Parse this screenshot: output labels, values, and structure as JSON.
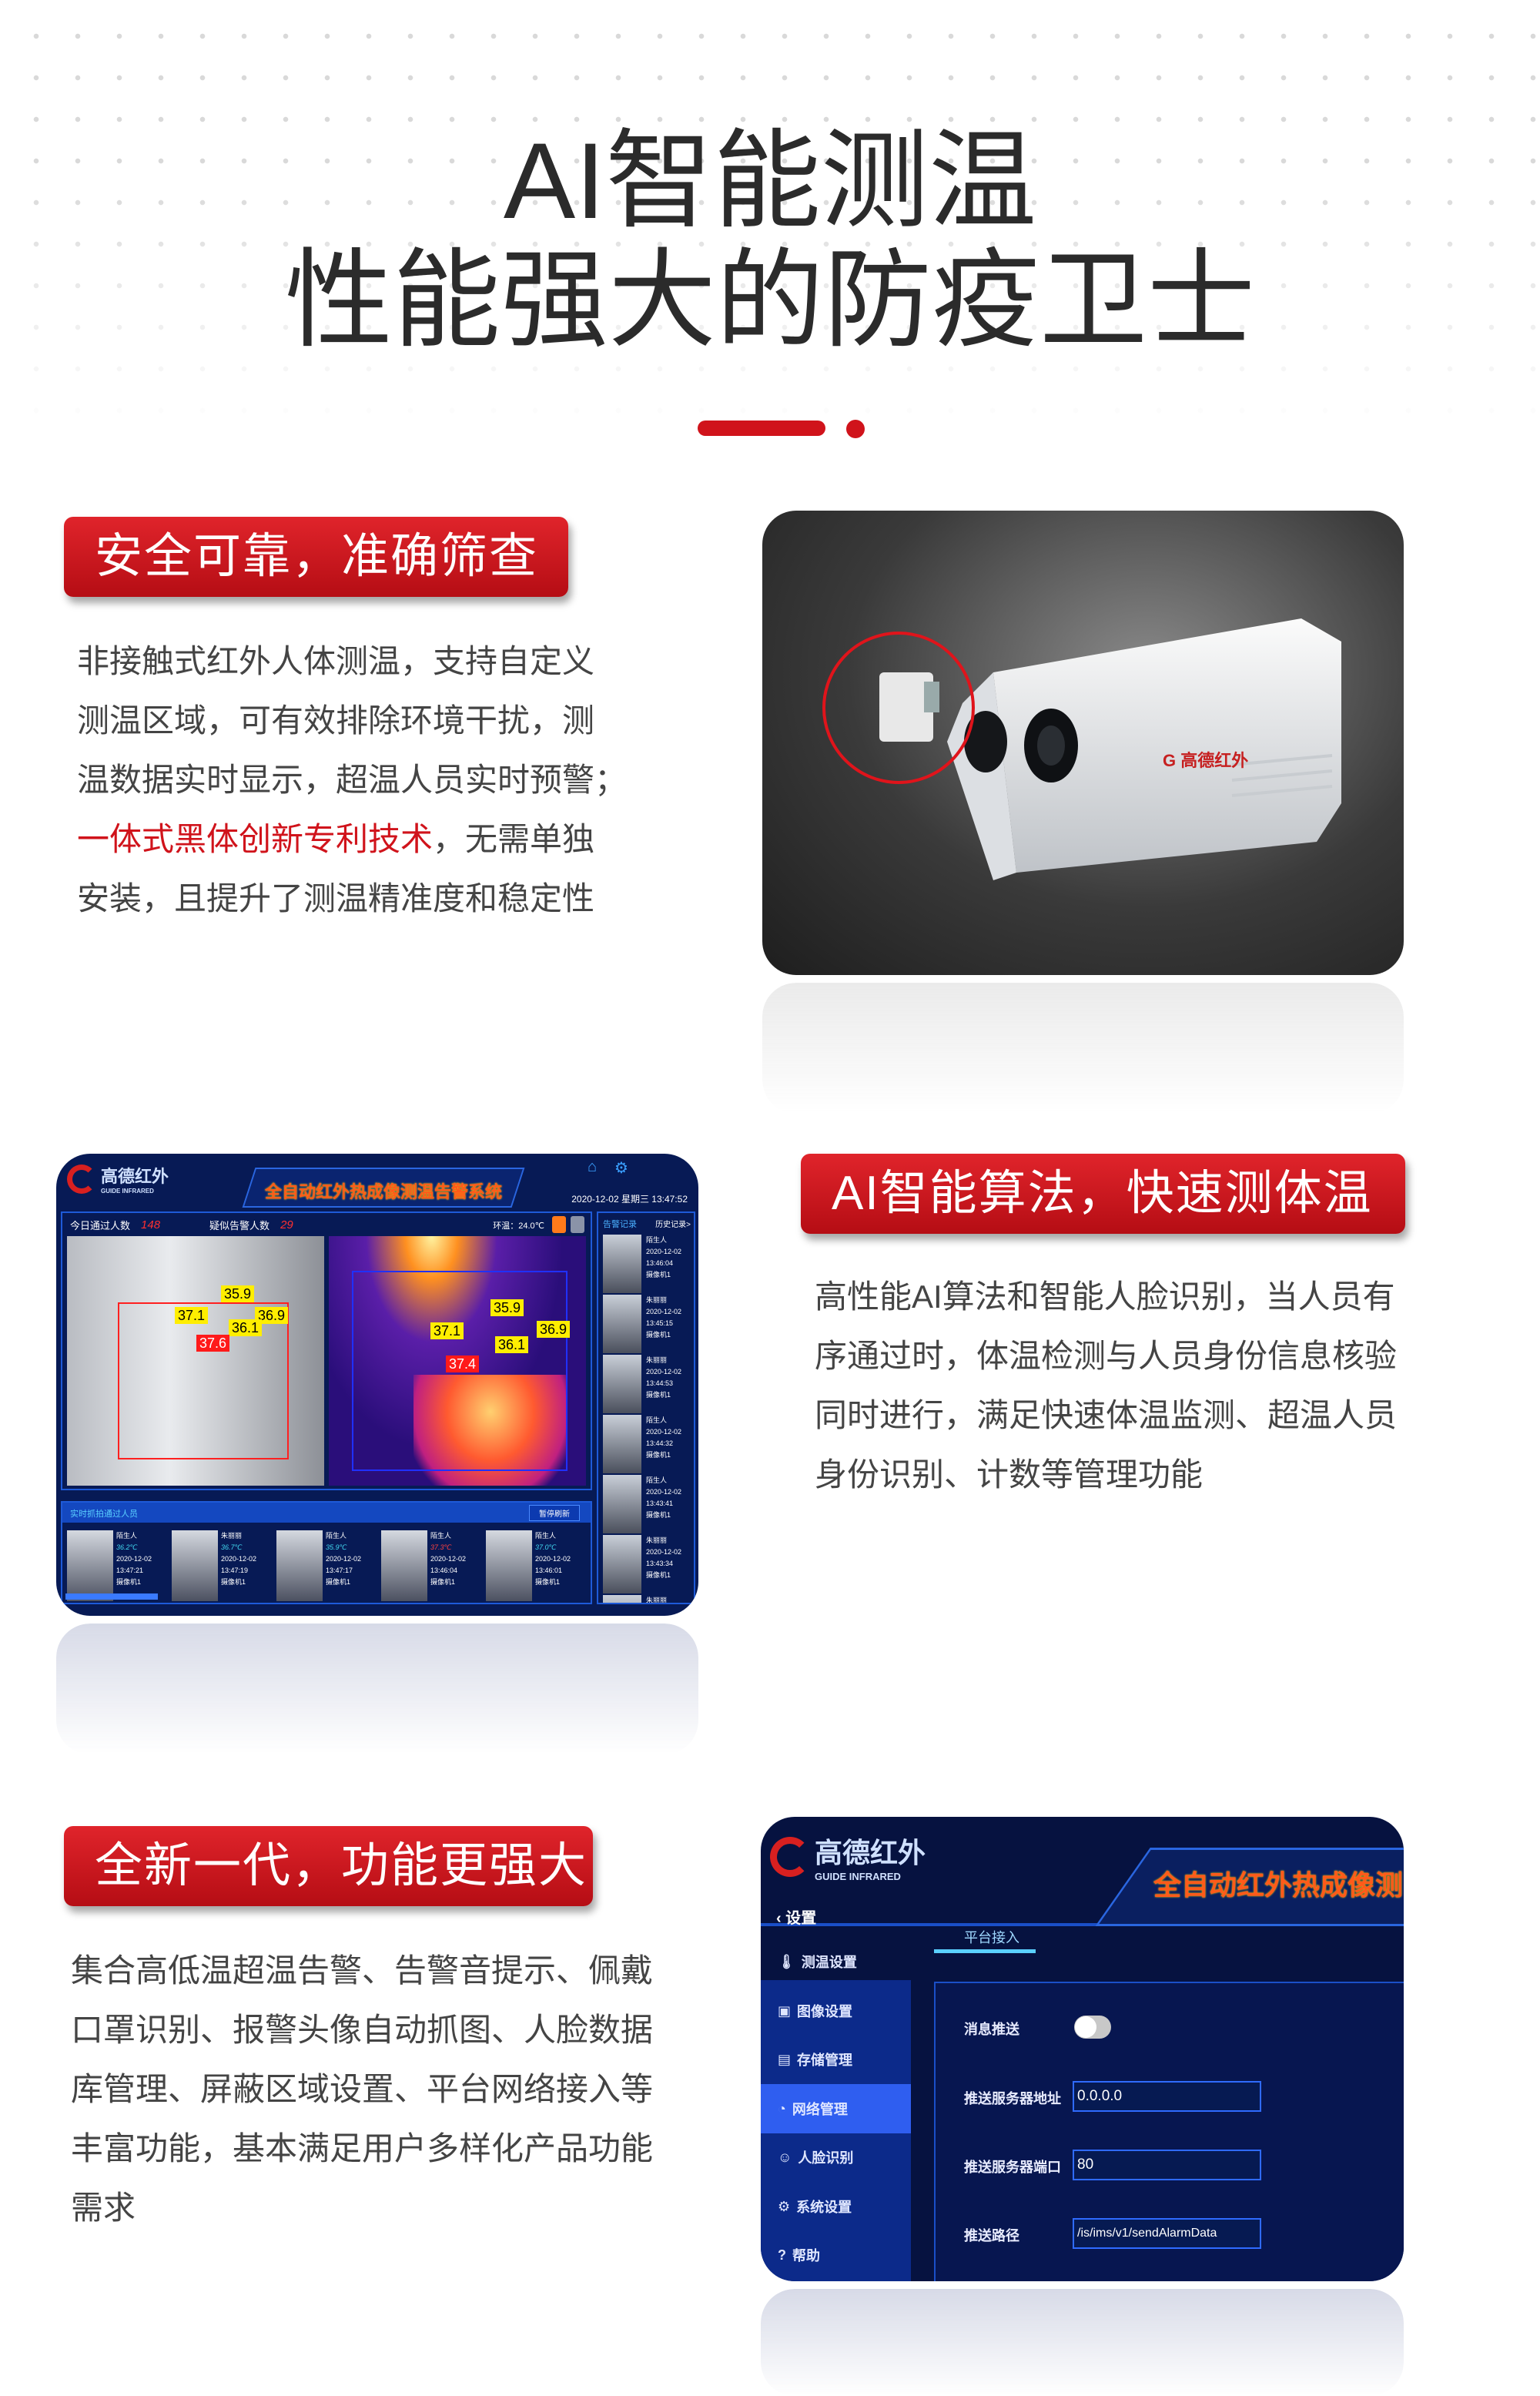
{
  "hero": {
    "title_line1": "AI智能测温",
    "title_line2": "性能强大的防疫卫士"
  },
  "colors": {
    "accent": "#d0131b",
    "ui_bg": "#071a55",
    "ui_active": "#2f5ef0"
  },
  "section1": {
    "badge": "安全可靠，准确筛查",
    "lines": [
      "非接触式红外人体测温，支持自定义",
      "测温区域，可有效排除环境干扰，测",
      "温数据实时显示，超温人员实时预警；",
      null,
      "安装，且提升了测温精准度和稳定性"
    ],
    "line4_red": "一体式黑体创新专利技术",
    "line4_rest": "，无需单独",
    "camera_logo": "高德红外",
    "camera_logo_sub": "GUIDE INFRARED"
  },
  "section2": {
    "badge": "AI智能算法，快速测体温",
    "lines": [
      "高性能AI算法和智能人脸识别，当人员有",
      "序通过时，体温检测与人员身份信息核验",
      "同时进行，满足快速体温监测、超温人员",
      "身份识别、计数等管理功能"
    ]
  },
  "dashboard": {
    "logo": "高德红外",
    "logo_sub": "GUIDE INFRARED",
    "title": "全自动红外热成像测温告警系统",
    "datetime": "2020-12-02 星期三 13:47:52",
    "passed_label": "今日通过人数",
    "passed_value": "148",
    "alarm_label": "疑似告警人数",
    "alarm_value": "29",
    "ambient": "环温：24.0℃",
    "visible_tags": [
      "35.9",
      "37.1",
      "36.9",
      "36.1",
      "37.6"
    ],
    "thermal_tags": [
      "35.9",
      "37.1",
      "36.9",
      "36.1",
      "37.4"
    ],
    "records_tab": "告警记录",
    "history_tab": "历史记录>",
    "records": [
      {
        "name": "陌生人",
        "date": "2020-12-02",
        "time": "13:46:04",
        "cam": "摄像机1"
      },
      {
        "name": "朱丽丽",
        "date": "2020-12-02",
        "time": "13:45:15",
        "cam": "摄像机1"
      },
      {
        "name": "朱丽丽",
        "date": "2020-12-02",
        "time": "13:44:53",
        "cam": "摄像机1"
      },
      {
        "name": "陌生人",
        "date": "2020-12-02",
        "time": "13:44:32",
        "cam": "摄像机1"
      },
      {
        "name": "陌生人",
        "date": "2020-12-02",
        "time": "13:43:41",
        "cam": "摄像机1"
      },
      {
        "name": "朱丽丽",
        "date": "2020-12-02",
        "time": "13:43:34",
        "cam": "摄像机1"
      },
      {
        "name": "朱丽丽"
      }
    ],
    "capture_title": "实时抓拍通过人员",
    "pause_button": "暂停刷新",
    "captures": [
      {
        "name": "陌生人",
        "temp": "36.2℃",
        "date": "2020-12-02",
        "time": "13:47:21",
        "cam": "摄像机1"
      },
      {
        "name": "朱丽丽",
        "temp": "36.7℃",
        "date": "2020-12-02",
        "time": "13:47:19",
        "cam": "摄像机1"
      },
      {
        "name": "陌生人",
        "temp": "35.9℃",
        "date": "2020-12-02",
        "time": "13:47:17",
        "cam": "摄像机1"
      },
      {
        "name": "陌生人",
        "temp": "37.3℃",
        "date": "2020-12-02",
        "time": "13:46:04",
        "cam": "摄像机1"
      },
      {
        "name": "陌生人",
        "temp": "37.0℃",
        "date": "2020-12-02",
        "time": "13:46:01",
        "cam": "摄像机1"
      }
    ]
  },
  "section3": {
    "badge": "全新一代，功能更强大",
    "lines": [
      "集合高低温超温告警、告警音提示、佩戴",
      "口罩识别、报警头像自动抓图、人脸数据",
      "库管理、屏蔽区域设置、平台网络接入等",
      "丰富功能，基本满足用户多样化产品功能",
      "需求"
    ]
  },
  "settings": {
    "logo": "高德红外",
    "logo_sub": "GUIDE INFRARED",
    "title": "全自动红外热成像测",
    "back_label": "设置",
    "menu": [
      {
        "label": "测温设置",
        "icon": "thermometer-icon"
      },
      {
        "label": "图像设置",
        "icon": "image-icon"
      },
      {
        "label": "存储管理",
        "icon": "storage-icon"
      },
      {
        "label": "网络管理",
        "icon": "network-icon",
        "active": true
      },
      {
        "label": "人脸识别",
        "icon": "face-icon"
      },
      {
        "label": "系统设置",
        "icon": "gear-icon"
      },
      {
        "label": "帮助",
        "icon": "help-icon"
      }
    ],
    "tab": "平台接入",
    "push_label": "消息推送",
    "push_enabled": false,
    "server_addr_label": "推送服务器地址",
    "server_addr": "0.0.0.0",
    "server_port_label": "推送服务器端口",
    "server_port": "80",
    "path_label": "推送路径",
    "path": "/is/ims/v1/sendAlarmData"
  }
}
